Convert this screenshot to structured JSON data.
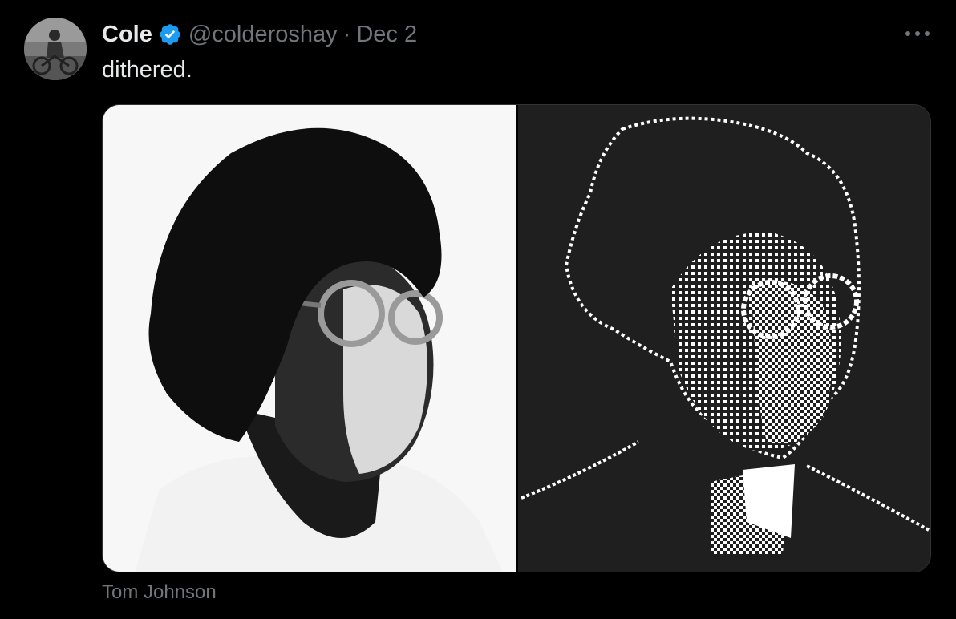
{
  "tweet": {
    "author_name": "Cole",
    "handle": "@colderoshay",
    "separator": "·",
    "date": "Dec 2",
    "text": "dithered.",
    "media_caption": "Tom Johnson"
  },
  "icons": {
    "verified": "verified-badge-icon",
    "more": "more-horizontal-icon"
  },
  "colors": {
    "background": "#000000",
    "primary_text": "#e7e9ea",
    "secondary_text": "#71767b",
    "verified_blue": "#1d9bf0",
    "media_border": "#2f3336",
    "dither_background": "#1f1f1f"
  }
}
